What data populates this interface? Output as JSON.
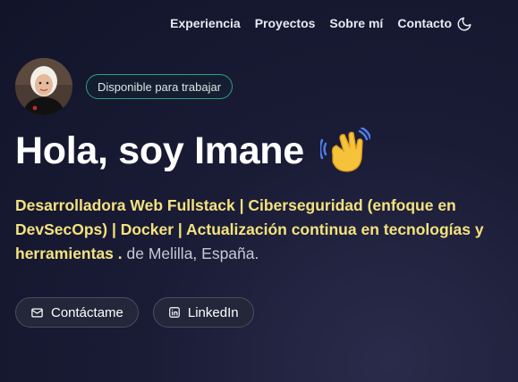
{
  "nav": {
    "items": [
      {
        "label": "Experiencia"
      },
      {
        "label": "Proyectos"
      },
      {
        "label": "Sobre mí"
      },
      {
        "label": "Contacto"
      }
    ],
    "theme_icon": "moon-icon"
  },
  "profile": {
    "badge": "Disponible para trabajar",
    "title": "Hola, soy Imane",
    "title_emoji_icon": "waving-hand-icon",
    "description_highlight": "Desarrolladora Web Fullstack | Ciberseguridad (enfoque en DevSecOps) | Docker | Actualización continua en tecnologías y herramientas .",
    "description_rest": " de Melilla, España."
  },
  "buttons": {
    "contact": {
      "label": "Contáctame",
      "icon": "mail-icon"
    },
    "linkedin": {
      "label": "LinkedIn",
      "icon": "linkedin-icon"
    }
  },
  "colors": {
    "background": "#1a1c36",
    "highlight": "#f4e27e",
    "badge_border": "#2f9e8a"
  }
}
